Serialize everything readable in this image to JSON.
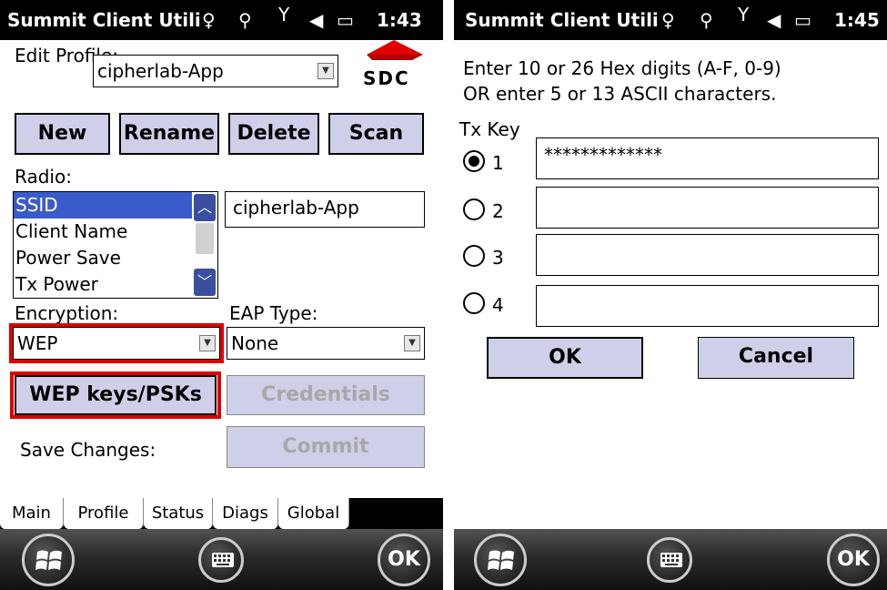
{
  "left": {
    "title": "Summit Client Utili",
    "time": "1:43",
    "edit_profile_label": "Edit Profile:",
    "profile_value": "cipherlab-App",
    "logo_text": "SDC",
    "buttons": {
      "new": "New",
      "rename": "Rename",
      "delete": "Delete",
      "scan": "Scan"
    },
    "radio_label": "Radio:",
    "radio_items": [
      "SSID",
      "Client Name",
      "Power Save",
      "Tx Power"
    ],
    "radio_selected": "SSID",
    "ssid_value": "cipherlab-App",
    "encryption_label": "Encryption:",
    "encryption_value": "WEP",
    "eap_label": "EAP Type:",
    "eap_value": "None",
    "wep_button": "WEP keys/PSKs",
    "credentials_button": "Credentials",
    "save_changes_label": "Save Changes:",
    "commit_button": "Commit",
    "tabs": [
      "Main",
      "Profile",
      "Status",
      "Diags",
      "Global"
    ],
    "active_tab": "Profile",
    "ok": "OK"
  },
  "right": {
    "title": "Summit Client Utili",
    "time": "1:45",
    "instruction_line1": "Enter 10 or 26 Hex digits (A-F, 0-9)",
    "instruction_line2": "OR enter 5 or 13 ASCII characters.",
    "tx_key_label": "Tx Key",
    "keys": [
      {
        "label": "1",
        "value": "*************",
        "selected": true
      },
      {
        "label": "2",
        "value": "",
        "selected": false
      },
      {
        "label": "3",
        "value": "",
        "selected": false
      },
      {
        "label": "4",
        "value": "",
        "selected": false
      }
    ],
    "ok_button": "OK",
    "cancel_button": "Cancel",
    "ok": "OK"
  },
  "colors": {
    "highlight": "#e00000",
    "button_bg": "#cfcfe9",
    "selection": "#3a5cc9",
    "titlebar": "#000000"
  },
  "icons": [
    "signal-icon",
    "wifi-icon",
    "antenna-icon",
    "volume-icon",
    "battery-icon",
    "windows-icon",
    "keyboard-icon",
    "ok-icon"
  ]
}
